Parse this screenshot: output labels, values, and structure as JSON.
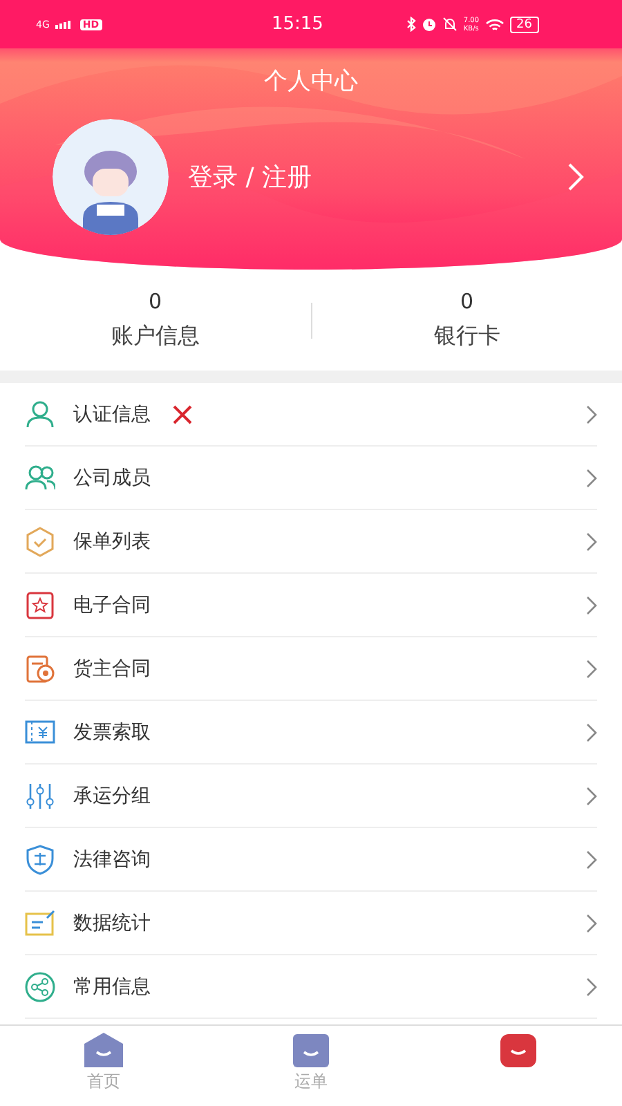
{
  "status_bar": {
    "network": "4G",
    "hd": "HD",
    "time": "15:15",
    "speed": "7.00",
    "speed_unit": "KB/s",
    "battery": "26"
  },
  "header": {
    "title": "个人中心",
    "login": "登录 / 注册"
  },
  "stats": [
    {
      "value": "0",
      "label": "账户信息"
    },
    {
      "value": "0",
      "label": "银行卡"
    }
  ],
  "menu": [
    {
      "kind": "person",
      "label": "认证信息",
      "verified": false
    },
    {
      "kind": "group",
      "label": "公司成员"
    },
    {
      "kind": "policy",
      "label": "保单列表"
    },
    {
      "kind": "contract",
      "label": "电子合同"
    },
    {
      "kind": "owner",
      "label": "货主合同"
    },
    {
      "kind": "invoice",
      "label": "发票索取"
    },
    {
      "kind": "sliders",
      "label": "承运分组"
    },
    {
      "kind": "law",
      "label": "法律咨询"
    },
    {
      "kind": "stats",
      "label": "数据统计"
    },
    {
      "kind": "share",
      "label": "常用信息"
    }
  ],
  "tabs": [
    {
      "kind": "home",
      "label": "首页",
      "selected": false
    },
    {
      "kind": "waybill",
      "label": "运单",
      "selected": false
    },
    {
      "kind": "mine",
      "selected": true
    }
  ]
}
